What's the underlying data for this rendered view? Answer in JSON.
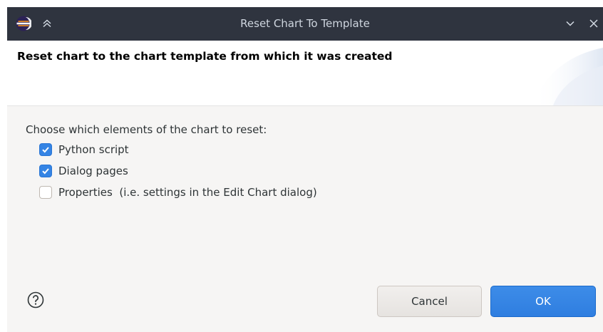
{
  "window": {
    "title": "Reset Chart To Template",
    "logo_icon": "eclipse-logo-icon",
    "shade_icon": "double-chevron-up-icon",
    "minimize_icon": "chevron-down-icon",
    "close_icon": "close-icon"
  },
  "header": {
    "title": "Reset chart to the chart template from which it was created"
  },
  "body": {
    "instructions": "Choose which elements of the chart to reset:",
    "options": [
      {
        "label": "Python script",
        "checked": true
      },
      {
        "label": "Dialog pages",
        "checked": true
      },
      {
        "label": "Properties  (i.e. settings in the Edit Chart dialog)",
        "checked": false
      }
    ]
  },
  "footer": {
    "help_icon": "help-icon",
    "cancel_label": "Cancel",
    "ok_label": "OK"
  },
  "colors": {
    "titlebar_bg": "#2f343f",
    "accent": "#3584e4",
    "body_bg": "#f6f5f4"
  }
}
